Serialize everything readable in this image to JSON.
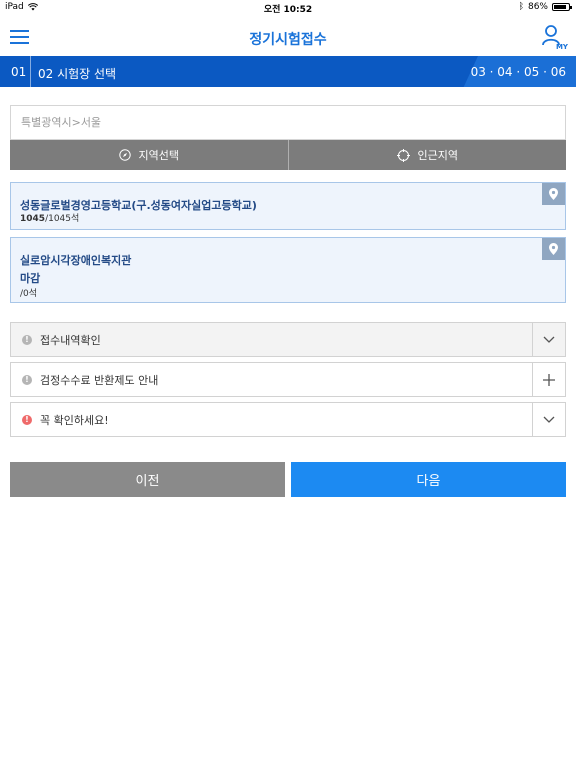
{
  "status_bar": {
    "device": "iPad",
    "time": "오전 10:52",
    "battery": "86%",
    "battery_level": 0.86
  },
  "header": {
    "title": "정기시험접수",
    "my_label": "MY"
  },
  "steps": {
    "step1": "01",
    "step2": "02  시험장 선택",
    "remaining": "03 · 04 · 05 · 06"
  },
  "region": {
    "placeholder": "특별광역시>서울",
    "select_button": "지역선택",
    "nearby_button": "인근지역"
  },
  "results": [
    {
      "name": "성동글로벌경영고등학교(구.성동여자실업고등학교)",
      "seats_bold": "1045",
      "seats_rest": "/1045석",
      "status": ""
    },
    {
      "name": "실로암시각장애인복지관",
      "status": "마감",
      "seats_bold": "",
      "seats_rest": "/0석"
    }
  ],
  "accordions": [
    {
      "label": "접수내역확인",
      "toggle": "chevron-down"
    },
    {
      "label": "검정수수료 반환제도 안내",
      "toggle": "plus"
    },
    {
      "label": "꼭 확인하세요!",
      "toggle": "chevron-down"
    }
  ],
  "nav": {
    "prev": "이전",
    "next": "다음"
  },
  "colors": {
    "brand_blue": "#1a73d9",
    "steps_bg": "#1b6fd6",
    "next_button": "#1c8af2",
    "prev_button": "#8a8a8a",
    "warning_red": "#ef6a6a"
  }
}
